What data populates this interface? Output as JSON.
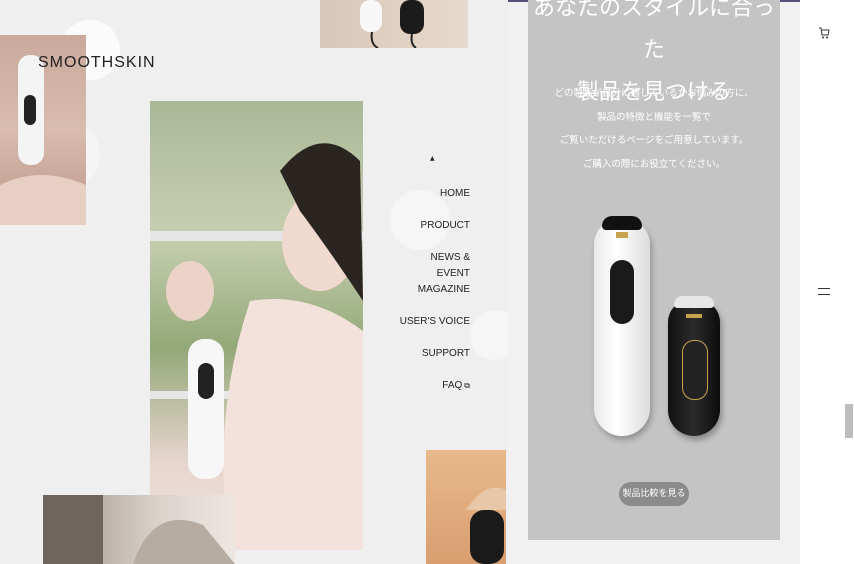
{
  "brand": {
    "logo": "SMOOTHSKIN"
  },
  "nav": {
    "items": [
      {
        "label": "HOME"
      },
      {
        "label": "PRODUCT"
      },
      {
        "label": "NEWS & EVENT"
      },
      {
        "label": "MAGAZINE"
      },
      {
        "label": "USER'S VOICE"
      },
      {
        "label": "SUPPORT"
      },
      {
        "label": "FAQ",
        "external_icon": "⧉"
      }
    ]
  },
  "panel": {
    "title_line1": "あなたのスタイルに合った",
    "title_line2": "製品を見つける",
    "desc_lines": [
      "どの製品が自分に適しているかお悩みの方に、",
      "製品の特徴と機能を一覧で",
      "ご覧いただけるページをご用意しています。",
      "ご購入の際にお役立てください。"
    ],
    "button_label": "製品比較を見る",
    "background_color": "#c4c4c4"
  },
  "icons": {
    "cart": "cart-icon",
    "menu": "hamburger-menu-icon",
    "nav_caret": "caret-up-icon",
    "external": "external-link-icon"
  }
}
